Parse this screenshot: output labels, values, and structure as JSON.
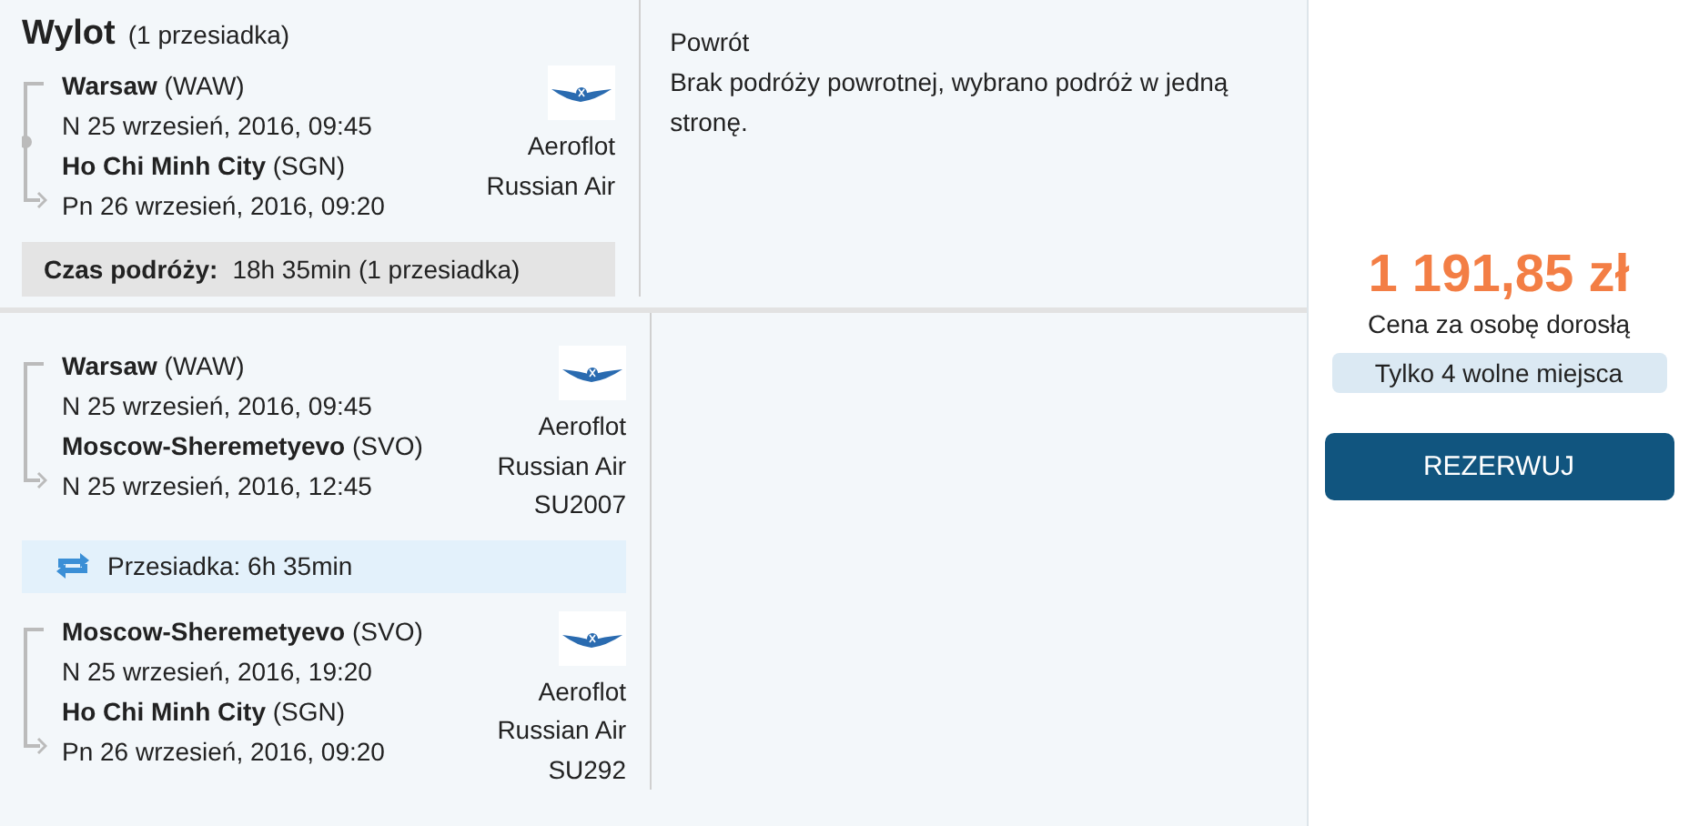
{
  "outbound": {
    "title": "Wylot",
    "stops": "(1 przesiadka)",
    "segments": [
      {
        "from": "**Warsaw** (WAW)",
        "from_date": "N 25 wrzesień, 2016, 09:45",
        "to": "**Ho Chi Minh City** (SGN)",
        "to_date": "Pn 26 wrzesień, 2016, 09:20",
        "stop_marker": true,
        "airline": [
          "Aeroflot",
          "Russian Air"
        ]
      }
    ],
    "duration": {
      "label": "Czas podróży:",
      "value": "18h 35min (1 przesiadka)"
    }
  },
  "return": {
    "title": "Powrót",
    "text": "Brak podróży powrotnej, wybrano podróż w jedną stronę."
  },
  "details": [
    {
      "kind": "segment",
      "from": "**Warsaw** (WAW)",
      "from_date": "N 25 wrzesień, 2016, 09:45",
      "to": "**Moscow-Sheremetyevo** (SVO)",
      "to_date": "N 25 wrzesień, 2016, 12:45",
      "stop_marker": false,
      "airline": [
        "Aeroflot",
        "Russian Air",
        "SU2007"
      ]
    },
    {
      "kind": "layover",
      "text": "Przesiadka: 6h 35min"
    },
    {
      "kind": "segment",
      "from": "**Moscow-Sheremetyevo** (SVO)",
      "from_date": "N 25 wrzesień, 2016, 19:20",
      "to": "**Ho Chi Minh City** (SGN)",
      "to_date": "Pn 26 wrzesień, 2016, 09:20",
      "stop_marker": false,
      "airline": [
        "Aeroflot",
        "Russian Air",
        "SU292"
      ]
    }
  ],
  "price": {
    "amount": "1 191,85 zł",
    "note": "Cena za osobę dorosłą",
    "seats": "Tylko 4 wolne miejsca",
    "button": "REZERWUJ"
  }
}
